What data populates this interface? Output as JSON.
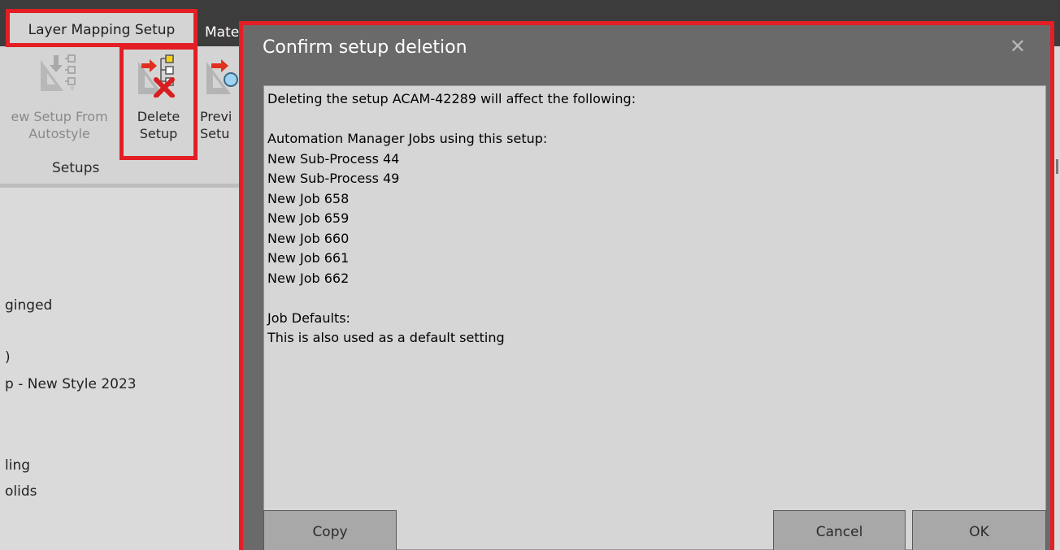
{
  "tabs": {
    "layer_mapping": "Layer Mapping Setup",
    "mate": "Mate"
  },
  "ribbon": {
    "new_setup_label": "ew Setup From\nAutostyle",
    "delete_setup_label": "Delete\nSetup",
    "preview_setup_label": "Previ\nSetu",
    "group_label": "Setups",
    "icons": {
      "new_setup": "new-setup-icon",
      "delete_setup": "delete-setup-icon",
      "preview_setup": "preview-setup-icon"
    }
  },
  "left_list": [
    "ginged",
    ")",
    "p - New Style 2023",
    "ling",
    "olids"
  ],
  "dialog": {
    "title": "Confirm setup deletion",
    "close_glyph": "✕",
    "lines": [
      "Deleting the setup ACAM-42289 will affect the following:",
      "",
      "Automation Manager Jobs using this setup:",
      "New Sub-Process 44",
      "New Sub-Process 49",
      "New Job 658",
      "New Job 659",
      "New Job 660",
      "New Job 661",
      "New Job 662",
      "",
      "Job Defaults:",
      "This is also used as a default setting"
    ],
    "buttons": {
      "copy": "Copy",
      "cancel": "Cancel",
      "ok": "OK"
    }
  },
  "colors": {
    "highlight": "#e31e24",
    "dialog_bg": "#6a6a6a",
    "content_bg": "#d6d6d6"
  }
}
